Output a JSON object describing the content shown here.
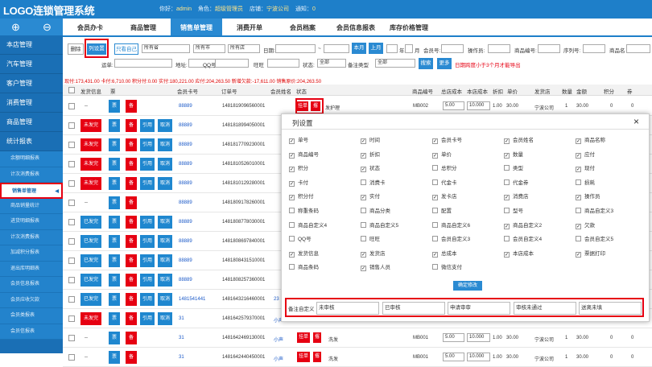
{
  "header": {
    "logo": "LOGO连锁管理系统",
    "greet": "你好：",
    "user": "admin",
    "role_label": "角色：",
    "role": "超级管理员",
    "store_label": "店铺：",
    "store": "宁波公司",
    "notice_label": "通知：",
    "notice": "0"
  },
  "iconbar": [
    "⊕",
    "⊖"
  ],
  "tabs": [
    "会员办卡",
    "商品管理",
    "销售单管理",
    "消费开单",
    "会员档案",
    "会员信息报表",
    "库存价格管理"
  ],
  "sidebar": {
    "groups": [
      "本店管理",
      "汽车管理",
      "客户管理",
      "消费管理",
      "商品管理",
      "统计报表"
    ],
    "subs": [
      "余额明细报表",
      "计次消费报表",
      "销售单管理",
      "商品销量统计",
      "进货明细报表",
      "计次消费报表",
      "加减积分报表",
      "退出库明细表",
      "会员信息报表",
      "会员应收欠款",
      "会员类报表",
      "会员信报表"
    ]
  },
  "toolbar": {
    "delete": "删除",
    "colset": "列设置",
    "only_self": "只看自己",
    "province": "所有省",
    "city": "所有市",
    "shop": "所有店",
    "date_label": "日期:",
    "range_sep": "~",
    "this_month": "本月",
    "last_month": "上月",
    "year": "年",
    "month": "月",
    "member_no": "会员号:",
    "operator": "操作员:",
    "goods_no": "商品编号:",
    "serial": "序列号:",
    "goods_name": "商品名",
    "shipping": "运单:",
    "address": "地址:",
    "qq": "QQ号",
    "wangwang": "旺旺",
    "status_label": "状态:",
    "status_val": "全部",
    "note_type": "备注类型",
    "note_val": "全部",
    "search": "搜索",
    "more": "更多",
    "warning": "日期跨度小于3个月才能导出"
  },
  "stats": "现付:173,431.00 卡付:6,710.00 积分付:0.00 实付:180,221.00 应付:204,263.50 新增欠款:-17,611.00 销售原价:204,263.50",
  "columns": [
    "发货信息",
    "票",
    "",
    "会员卡号",
    "订单号",
    "会员姓名",
    "状态",
    "商品编号",
    "总店成本",
    "本店成本",
    "折扣",
    "单价",
    "发货店",
    "数量",
    "金额",
    "积分",
    "券"
  ],
  "rows": [
    {
      "ship": "",
      "card": "88889",
      "order": "1481819096560001",
      "ops": [
        "票",
        "备"
      ]
    },
    {
      "ship": "未发完",
      "card": "88889",
      "order": "1481818994050001",
      "ops": [
        "票",
        "备",
        "引用",
        "取消"
      ]
    },
    {
      "ship": "未发完",
      "card": "88889",
      "order": "1481817709230001",
      "ops": [
        "票",
        "备",
        "引用",
        "取消"
      ]
    },
    {
      "ship": "未发完",
      "card": "88889",
      "order": "1481810526010001",
      "ops": [
        "票",
        "备",
        "引用",
        "取消"
      ]
    },
    {
      "ship": "未发完",
      "card": "88889",
      "order": "1481810129280001",
      "ops": [
        "票",
        "备",
        "引用",
        "取消"
      ]
    },
    {
      "ship": "",
      "card": "88889",
      "order": "1481809178260001",
      "ops": [
        "票",
        "备"
      ]
    },
    {
      "ship": "已发完",
      "card": "88889",
      "order": "1481808778030001",
      "ops": [
        "票",
        "备",
        "引用",
        "取消"
      ]
    },
    {
      "ship": "已发完",
      "card": "88889",
      "order": "1481808697840001",
      "ops": [
        "票",
        "备",
        "引用",
        "取消"
      ]
    },
    {
      "ship": "已发完",
      "card": "88889",
      "order": "1481808431510001",
      "ops": [
        "票",
        "备",
        "引用",
        "取消"
      ]
    },
    {
      "ship": "已发完",
      "card": "88889",
      "order": "1481808257360001",
      "ops": [
        "票",
        "备",
        "引用",
        "取消"
      ]
    },
    {
      "ship": "已发完",
      "card": "1481541441",
      "order": "1481643216460001",
      "name": "23",
      "ops": [
        "票",
        "备",
        "引用",
        "取消"
      ]
    },
    {
      "ship": "未发完",
      "card": "31",
      "order": "1481642579370001",
      "name": "小声",
      "ops": [
        "票",
        "备",
        "引用",
        "取消"
      ]
    },
    {
      "ship": "",
      "card": "31",
      "order": "1481642469130001",
      "name": "小声",
      "ops": [
        "票",
        "备"
      ],
      "state": "挂单",
      "btn2": "撂",
      "item": "洗发",
      "code": "MB001",
      "cost1": "5.00",
      "cost2": "10.000",
      "disc": "1.00",
      "price": "30.00",
      "store": "宁波公司",
      "qty": "1",
      "amt": "30.00",
      "pts": "0",
      "coup": "0"
    },
    {
      "ship": "",
      "card": "31",
      "order": "1481642440450001",
      "name": "小声",
      "ops": [
        "票",
        "备"
      ],
      "state": "挂单",
      "btn2": "撂",
      "item": "洗发",
      "code": "MB001",
      "cost1": "5.00",
      "cost2": "10.000",
      "disc": "1.00",
      "price": "30.00",
      "store": "宁波公司",
      "qty": "1",
      "amt": "30.00",
      "pts": "0",
      "coup": "0"
    }
  ],
  "row0": {
    "state": "挂单",
    "btn2": "撂",
    "item": "发护理",
    "code": "MB002",
    "cost1": "5.00",
    "cost2": "10.000",
    "disc": "1.00",
    "price": "30.00",
    "store": "宁波公司",
    "qty": "1",
    "amt": "30.00",
    "pts": "0",
    "coup": "0"
  },
  "modal": {
    "title": "列设置",
    "close": "×",
    "ok": "确定修改",
    "options": [
      [
        "单号",
        "时间",
        "会员卡号",
        "会员姓名",
        "商品名称"
      ],
      [
        "商品编号",
        "折扣",
        "单价",
        "数量",
        "应付"
      ],
      [
        "积分",
        "状态",
        "总积分",
        "类型",
        "现付"
      ],
      [
        "卡付",
        "消费卡",
        "代金卡",
        "代金券",
        "损耗"
      ],
      [
        "积分付",
        "实付",
        "发卡店",
        "消费店",
        "操作员"
      ],
      [
        "称重条码",
        "商品分类",
        "配置",
        "型号",
        "商品自定义3"
      ],
      [
        "商品自定义4",
        "商品自定义5",
        "商品自定义6",
        "商品自定义2",
        "欠款"
      ],
      [
        "QQ号",
        "旺旺",
        "会员自定义3",
        "会员自定义4",
        "会员自定义5"
      ],
      [
        "发货信息",
        "发货店",
        "总成本",
        "本店成本",
        "票据打印"
      ],
      [
        "商品条码",
        "销售人员",
        "微信支付",
        "",
        ""
      ]
    ],
    "checked": [
      [
        1,
        1,
        1,
        1,
        1
      ],
      [
        1,
        1,
        1,
        1,
        1
      ],
      [
        1,
        1,
        0,
        0,
        1
      ],
      [
        1,
        0,
        0,
        0,
        0
      ],
      [
        1,
        1,
        1,
        1,
        1
      ],
      [
        0,
        0,
        0,
        0,
        0
      ],
      [
        0,
        0,
        0,
        1,
        1
      ],
      [
        0,
        0,
        0,
        0,
        0
      ],
      [
        1,
        1,
        1,
        1,
        1
      ],
      [
        0,
        1,
        0,
        0,
        0
      ]
    ],
    "custom_label": "备注自定义",
    "custom": [
      "未审核",
      "已审核",
      "申请审审",
      "审核未通过",
      "送离未填"
    ]
  }
}
